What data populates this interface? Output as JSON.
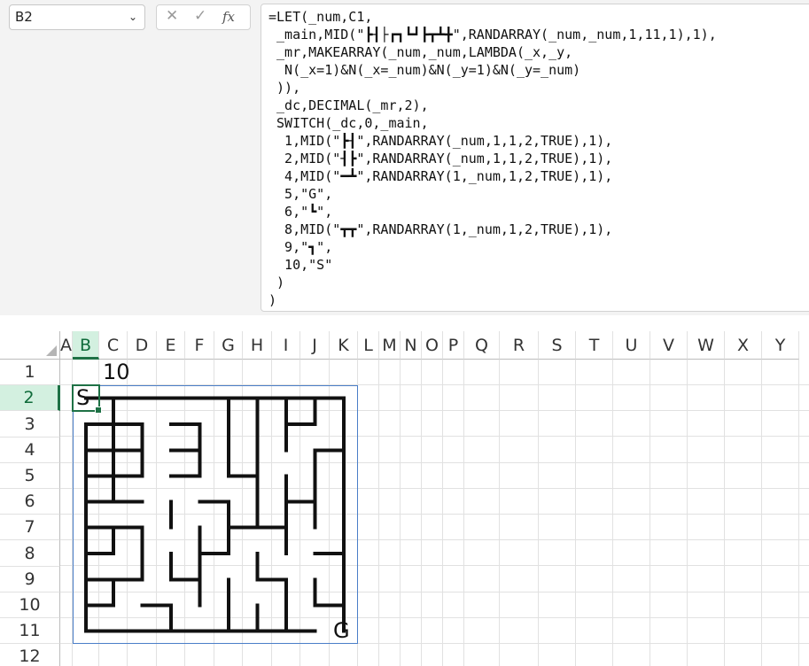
{
  "name_box": {
    "value": "B2"
  },
  "icons": {
    "cancel": "close-icon",
    "enter": "check-icon",
    "fx": "fx-icon",
    "dropdown": "chevron-down-icon"
  },
  "formula_lines": [
    "=LET(_num,C1,",
    " _main,MID(\"┣┨├┏┓┗┛┣┳┻╋\",RANDARRAY(_num,_num,1,11,1),1),",
    " _mr,MAKEARRAY(_num,_num,LAMBDA(_x,_y,",
    "  N(_x=1)&N(_x=_num)&N(_y=1)&N(_y=_num)",
    " )),",
    " _dc,DECIMAL(_mr,2),",
    " SWITCH(_dc,0,_main,",
    "  1,MID(\"┣┨\",RANDARRAY(_num,1,1,2,TRUE),1),",
    "  2,MID(\"┨┣\",RANDARRAY(_num,1,1,2,TRUE),1),",
    "  4,MID(\"━┻\",RANDARRAY(1,_num,1,2,TRUE),1),",
    "  5,\"G\",",
    "  6,\"┗\",",
    "  8,MID(\"┳┳\",RANDARRAY(1,_num,1,2,TRUE),1),",
    "  9,\"┓\",",
    "  10,\"S\"",
    " )",
    ")"
  ],
  "columns": [
    "A",
    "B",
    "C",
    "D",
    "E",
    "F",
    "G",
    "H",
    "I",
    "J",
    "K",
    "L",
    "M",
    "N",
    "O",
    "P",
    "Q",
    "R",
    "S",
    "T",
    "U",
    "V",
    "W",
    "X",
    "Y"
  ],
  "rows": [
    "1",
    "2",
    "3",
    "4",
    "5",
    "6",
    "7",
    "8",
    "9",
    "10",
    "11",
    "12"
  ],
  "selected_cell": "B2",
  "cells": {
    "C1": "10",
    "B2": "S",
    "K11": "G"
  },
  "colors": {
    "accent": "#1e7145",
    "selected_header_bg": "#d3f0e0",
    "spill_border": "#4a7ec8",
    "gridline": "#e1e1e1"
  }
}
